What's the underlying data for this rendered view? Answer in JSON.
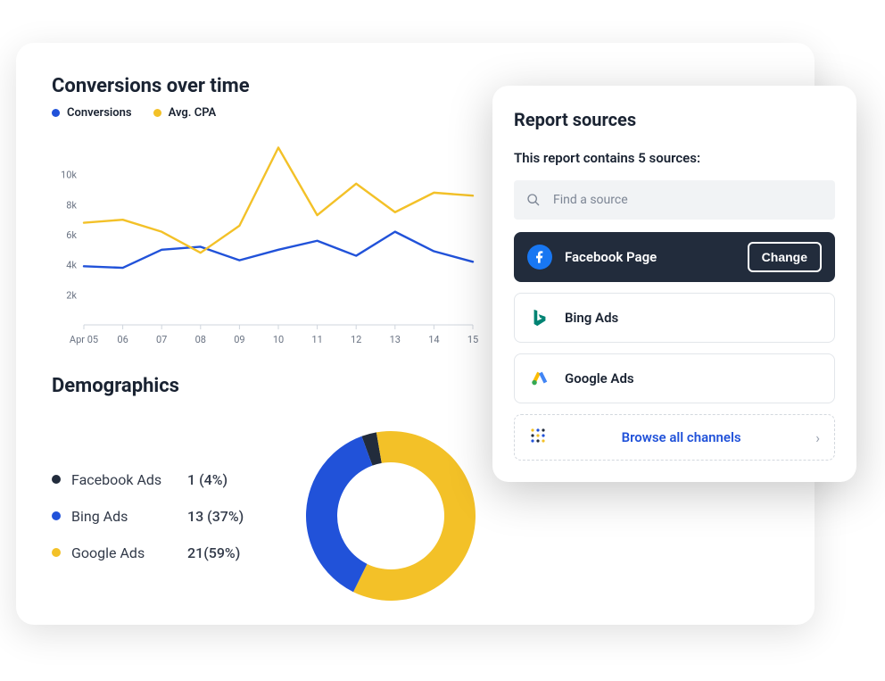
{
  "chart_title": "Conversions over time",
  "line_legend": [
    {
      "label": "Conversions",
      "colorClass": "dot-blue"
    },
    {
      "label": "Avg. CPA",
      "colorClass": "dot-yellow"
    }
  ],
  "chart_data": [
    {
      "type": "line",
      "title": "Conversions over time",
      "xlabel": "",
      "ylabel": "",
      "ylim": [
        0,
        12000
      ],
      "categories": [
        "Apr 05",
        "06",
        "07",
        "08",
        "09",
        "10",
        "11",
        "12",
        "13",
        "14",
        "15"
      ],
      "y_ticks": [
        "2k",
        "4k",
        "6k",
        "8k",
        "10k"
      ],
      "series": [
        {
          "name": "Conversions",
          "color": "#2152d9",
          "values": [
            3900,
            3800,
            5000,
            5200,
            4300,
            5000,
            5600,
            4600,
            6200,
            4900,
            4200
          ]
        },
        {
          "name": "Avg. CPA",
          "color": "#f3c128",
          "values": [
            6800,
            7000,
            6200,
            4800,
            6600,
            11800,
            7300,
            9400,
            7500,
            8800,
            8600
          ]
        }
      ]
    },
    {
      "type": "pie",
      "title": "Demographics",
      "categories": [
        "Facebook Ads",
        "Bing Ads",
        "Google Ads"
      ],
      "values": [
        1,
        13,
        21
      ],
      "percent": [
        4,
        37,
        59
      ],
      "colors": [
        "#222c3c",
        "#2152d9",
        "#f3c128"
      ]
    }
  ],
  "demographics_title": "Demographics",
  "demographics_legend": [
    {
      "name": "Facebook Ads",
      "value": "1 (4%)",
      "colorClass": "dot-dark"
    },
    {
      "name": "Bing Ads",
      "value": "13 (37%)",
      "colorClass": "dot-blue"
    },
    {
      "name": "Google Ads",
      "value": "21(59%)",
      "colorClass": "dot-yellow"
    }
  ],
  "sources": {
    "title": "Report sources",
    "subtitle": "This report contains 5 sources:",
    "search_placeholder": "Find a source",
    "selected": {
      "label": "Facebook Page",
      "change": "Change"
    },
    "others": [
      {
        "label": "Bing Ads",
        "icon": "bing"
      },
      {
        "label": "Google Ads",
        "icon": "google"
      }
    ],
    "browse_label": "Browse all channels"
  },
  "colors": {
    "blue": "#2152d9",
    "yellow": "#f3c128",
    "dark": "#222c3c"
  }
}
